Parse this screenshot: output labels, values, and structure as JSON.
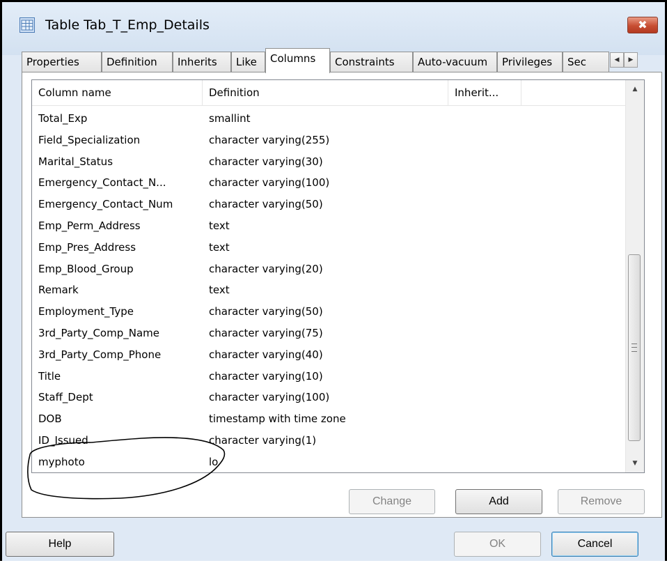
{
  "window": {
    "title": "Table Tab_T_Emp_Details",
    "close_glyph": "✖"
  },
  "tabs": [
    {
      "label": "Properties"
    },
    {
      "label": "Definition"
    },
    {
      "label": "Inherits"
    },
    {
      "label": "Like"
    },
    {
      "label": "Columns"
    },
    {
      "label": "Constraints"
    },
    {
      "label": "Auto-vacuum"
    },
    {
      "label": "Privileges"
    },
    {
      "label": "Sec"
    }
  ],
  "active_tab": "Columns",
  "tab_scroll": {
    "left_glyph": "◀",
    "right_glyph": "▶"
  },
  "columns_list": {
    "headers": [
      "Column name",
      "Definition",
      "Inherit..."
    ],
    "rows": [
      {
        "name": "Total_Exp",
        "definition": "smallint"
      },
      {
        "name": "Field_Specialization",
        "definition": "character varying(255)"
      },
      {
        "name": "Marital_Status",
        "definition": "character varying(30)"
      },
      {
        "name": "Emergency_Contact_N...",
        "definition": "character varying(100)"
      },
      {
        "name": "Emergency_Contact_Num",
        "definition": "character varying(50)"
      },
      {
        "name": "Emp_Perm_Address",
        "definition": "text"
      },
      {
        "name": "Emp_Pres_Address",
        "definition": "text"
      },
      {
        "name": "Emp_Blood_Group",
        "definition": "character varying(20)"
      },
      {
        "name": "Remark",
        "definition": "text"
      },
      {
        "name": "Employment_Type",
        "definition": "character varying(50)"
      },
      {
        "name": "3rd_Party_Comp_Name",
        "definition": "character varying(75)"
      },
      {
        "name": "3rd_Party_Comp_Phone",
        "definition": "character varying(40)"
      },
      {
        "name": "Title",
        "definition": "character varying(10)"
      },
      {
        "name": "Staff_Dept",
        "definition": "character varying(100)"
      },
      {
        "name": "DOB",
        "definition": "timestamp with time zone"
      },
      {
        "name": "ID_Issued",
        "definition": "character varying(1)"
      },
      {
        "name": "myphoto",
        "definition": "lo"
      }
    ],
    "scroll": {
      "up_glyph": "▲",
      "down_glyph": "▼"
    }
  },
  "panel_buttons": {
    "change": "Change",
    "add": "Add",
    "remove": "Remove"
  },
  "footer_buttons": {
    "help": "Help",
    "ok": "OK",
    "cancel": "Cancel"
  },
  "colors": {
    "title_bg": "#dfe9f5",
    "close_red": "#c74e33",
    "annotation": "#000000"
  }
}
